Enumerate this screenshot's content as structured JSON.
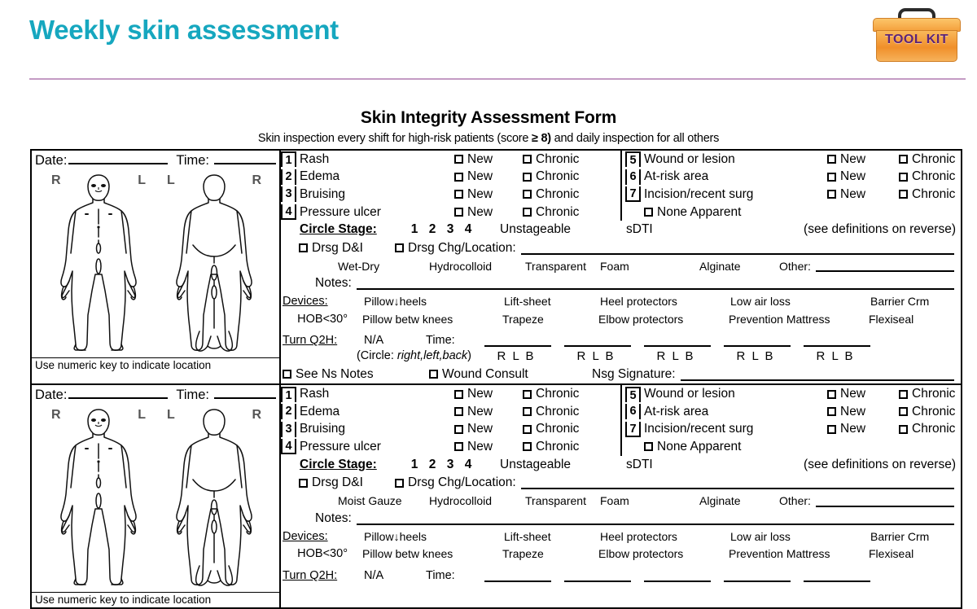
{
  "slide": {
    "title": "Weekly skin assessment",
    "accent_color": "#16a7bf",
    "divider_color": "#c49bc4",
    "logo": {
      "text": "TOOL KIT",
      "body_color": "#f0902a",
      "text_color": "#5c2478"
    }
  },
  "form": {
    "title": "Skin Integrity Assessment Form",
    "subtitle_pre": "Skin inspection every shift for high-risk patients (score ",
    "subtitle_bold": "≥ 8)",
    "subtitle_post": " and daily inspection for all others",
    "date_label": "Date:",
    "time_label": "Time:",
    "numeric_key_note": "Use numeric key to indicate location",
    "figure_labels": {
      "front_left": "R",
      "front_right": "L",
      "back_left": "L",
      "back_right": "R"
    },
    "items_left": [
      {
        "num": "1",
        "label": "Rash",
        "new": "New",
        "chronic": "Chronic"
      },
      {
        "num": "2",
        "label": "Edema",
        "new": "New",
        "chronic": "Chronic"
      },
      {
        "num": "3",
        "label": "Bruising",
        "new": "New",
        "chronic": "Chronic"
      },
      {
        "num": "4",
        "label": "Pressure ulcer",
        "new": "New",
        "chronic": "Chronic"
      }
    ],
    "items_right": [
      {
        "num": "5",
        "label": "Wound or lesion",
        "new": "New",
        "chronic": "Chronic"
      },
      {
        "num": "6",
        "label": "At-risk area",
        "new": "New",
        "chronic": "Chronic"
      },
      {
        "num": "7",
        "label": "Incision/recent surg",
        "new": "New",
        "chronic": "Chronic"
      }
    ],
    "none_apparent": "None Apparent",
    "stage": {
      "label": "Circle Stage:",
      "options": [
        "1",
        "2",
        "3",
        "4"
      ],
      "unstageable": "Unstageable",
      "sdti": "sDTI",
      "definitions_note": "(see definitions on reverse)"
    },
    "dressing": {
      "drsg_di": "Drsg D&I",
      "drsg_chg": "Drsg Chg/Location:",
      "other_label": "Other:",
      "types_section1": [
        "Wet-Dry",
        "Hydrocolloid",
        "Transparent",
        "Foam",
        "Alginate"
      ],
      "types_section2": [
        "Moist Gauze",
        "Hydrocolloid",
        "Transparent",
        "Foam",
        "Alginate"
      ],
      "notes_label": "Notes:"
    },
    "devices": {
      "heading": "Devices:",
      "row1": [
        "Pillow↓heels",
        "Lift-sheet",
        "Heel protectors",
        "Low air loss",
        "Barrier Crm"
      ],
      "row2_label": "HOB<30°",
      "row2": [
        "Pillow betw knees",
        "Trapeze",
        "Elbow protectors",
        "Prevention Mattress",
        "Flexiseal"
      ]
    },
    "turn": {
      "label": "Turn Q2H:",
      "na": "N/A",
      "time": "Time:",
      "circle_note_pre": "(Circle: ",
      "circle_note_italic": "right,left,back",
      "circle_note_post": ")",
      "rlb": "R L B",
      "rlb_count": 5
    },
    "footer": {
      "see_ns_notes": "See Ns Notes",
      "wound_consult": "Wound Consult",
      "nsg_signature": "Nsg Signature:"
    }
  }
}
